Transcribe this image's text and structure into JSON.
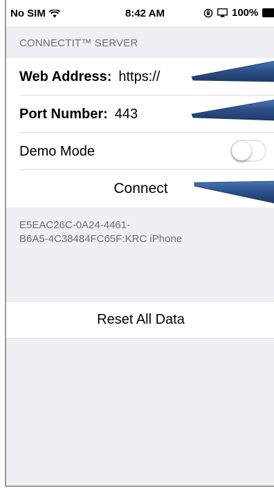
{
  "status_bar": {
    "carrier": "No SIM",
    "time": "8:42 AM",
    "battery": "100%"
  },
  "server": {
    "header": "CONNECTIT™ SERVER",
    "web_address_label": "Web Address:",
    "web_address_value": "https://",
    "port_label": "Port Number:",
    "port_value": "443",
    "demo_mode_label": "Demo Mode",
    "demo_mode_on": false,
    "connect_label": "Connect"
  },
  "device_id": {
    "line1": "E5EAC26C-0A24-4461-",
    "line2": "B6A5-4C38484FC65F:KRC iPhone"
  },
  "reset": {
    "label": "Reset All Data"
  },
  "colors": {
    "group_background": "#efeff4",
    "callout_arrow": "#2b4f86",
    "secondary_text": "#6d6d72"
  },
  "icons": [
    "wifi-icon",
    "orientation-lock-icon",
    "airplay-icon",
    "battery-icon",
    "callout-arrow-icon"
  ]
}
